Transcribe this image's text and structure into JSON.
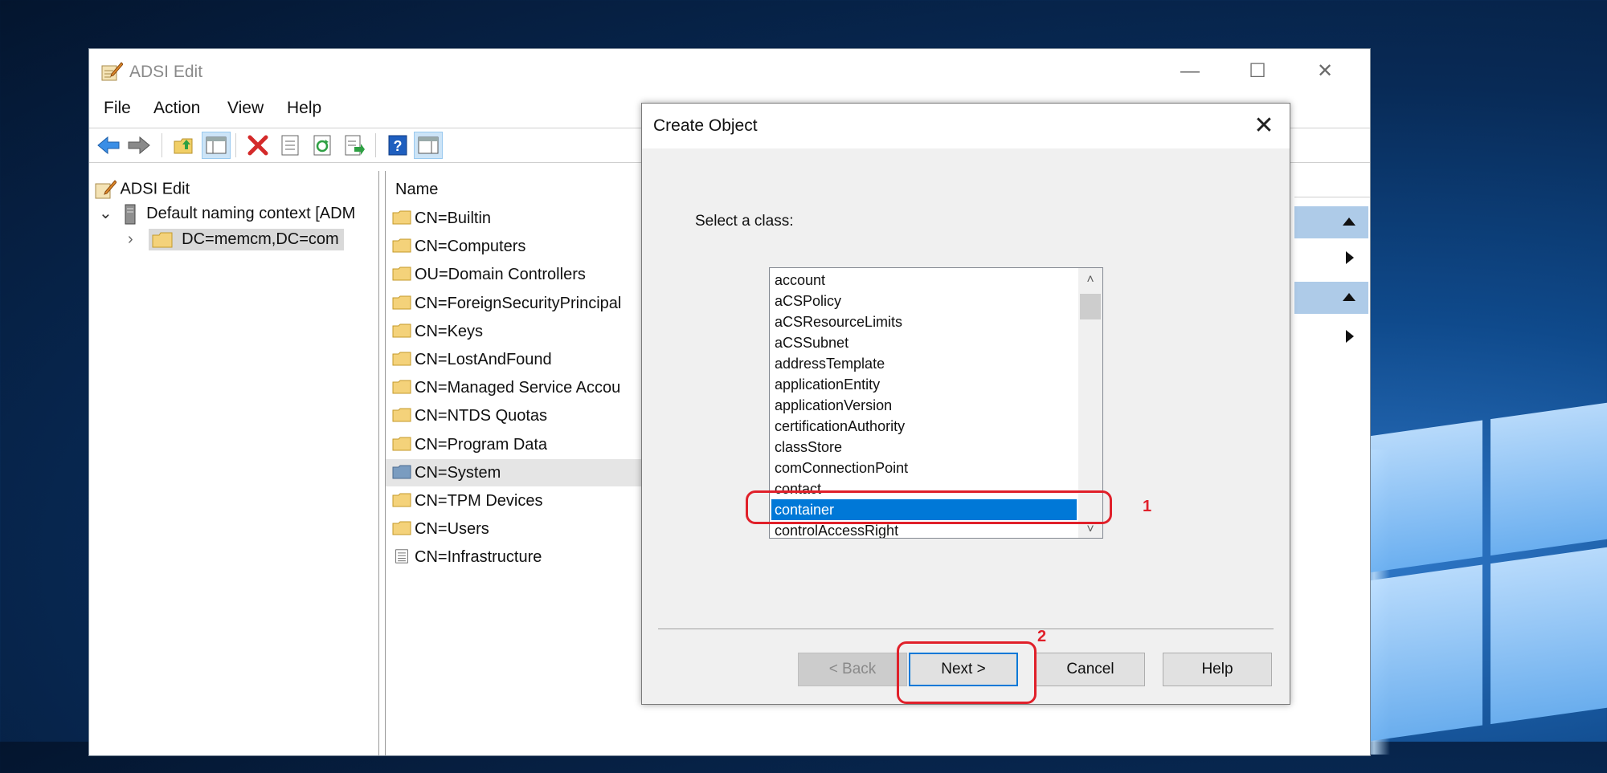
{
  "window": {
    "title": "ADSI Edit",
    "controls": {
      "minimize": "—",
      "maximize": "☐",
      "close": "✕"
    }
  },
  "menu": [
    "File",
    "Action",
    "View",
    "Help"
  ],
  "toolbar": {
    "icons": [
      "back-icon",
      "forward-icon",
      "up-folder-icon",
      "show-hide-tree-icon",
      "delete-icon",
      "properties-icon",
      "refresh-icon",
      "export-list-icon",
      "help-icon",
      "show-hide-action-pane-icon"
    ]
  },
  "tree": {
    "root": "ADSI Edit",
    "context": "Default naming context [ADM",
    "domain": "DC=memcm,DC=com"
  },
  "list": {
    "column": "Name",
    "items": [
      {
        "name": "CN=Builtin",
        "icon": "folder"
      },
      {
        "name": "CN=Computers",
        "icon": "folder"
      },
      {
        "name": "OU=Domain Controllers",
        "icon": "folder"
      },
      {
        "name": "CN=ForeignSecurityPrincipal",
        "icon": "folder"
      },
      {
        "name": "CN=Keys",
        "icon": "folder"
      },
      {
        "name": "CN=LostAndFound",
        "icon": "folder"
      },
      {
        "name": "CN=Managed Service Accou",
        "icon": "folder"
      },
      {
        "name": "CN=NTDS Quotas",
        "icon": "folder"
      },
      {
        "name": "CN=Program Data",
        "icon": "folder"
      },
      {
        "name": "CN=System",
        "icon": "folder-selected"
      },
      {
        "name": "CN=TPM Devices",
        "icon": "folder"
      },
      {
        "name": "CN=Users",
        "icon": "folder"
      },
      {
        "name": "CN=Infrastructure",
        "icon": "document"
      }
    ]
  },
  "dialog": {
    "title": "Create Object",
    "close": "✕",
    "prompt": "Select a class:",
    "classes": [
      "account",
      "aCSPolicy",
      "aCSResourceLimits",
      "aCSSubnet",
      "addressTemplate",
      "applicationEntity",
      "applicationVersion",
      "certificationAuthority",
      "classStore",
      "comConnectionPoint",
      "contact",
      "container",
      "controlAccessRight"
    ],
    "selected": "container",
    "buttons": {
      "back": "< Back",
      "next": "Next >",
      "cancel": "Cancel",
      "help": "Help"
    }
  },
  "annotations": {
    "one": "1",
    "two": "2"
  },
  "colors": {
    "accent": "#0078d7",
    "annotation": "#e0202a"
  }
}
